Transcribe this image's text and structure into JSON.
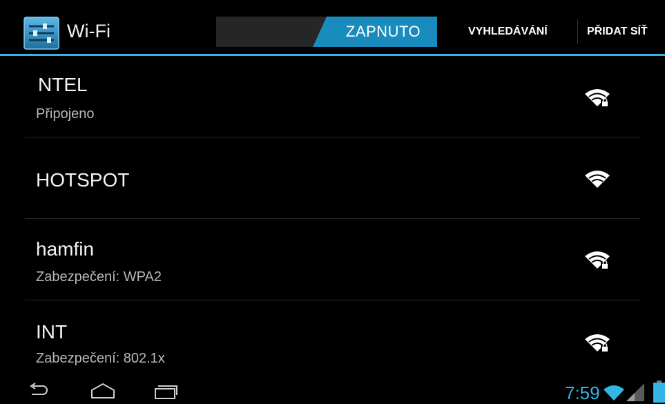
{
  "actionbar": {
    "title": "Wi-Fi",
    "toggle_label": "ZAPNUTO",
    "search_label": "VYHLEDÁVÁNÍ",
    "add_network_label": "PŘIDAT SÍŤ",
    "accent_color": "#33b5e5"
  },
  "networks": [
    {
      "ssid": "NTEL",
      "status": "Připojeno",
      "secured": true,
      "icon": "wifi-lock-icon"
    },
    {
      "ssid": "HOTSPOT",
      "status": "",
      "secured": false,
      "icon": "wifi-icon"
    },
    {
      "ssid": "hamfin",
      "status": "Zabezpečení: WPA2",
      "secured": true,
      "icon": "wifi-lock-icon"
    },
    {
      "ssid": "INT",
      "status": "Zabezpečení: 802.1x",
      "secured": true,
      "icon": "wifi-lock-icon"
    }
  ],
  "statusbar": {
    "time": "7:59",
    "icons": [
      "back-icon",
      "home-icon",
      "recent-apps-icon",
      "wifi-signal-icon",
      "cell-signal-icon",
      "battery-icon"
    ]
  }
}
